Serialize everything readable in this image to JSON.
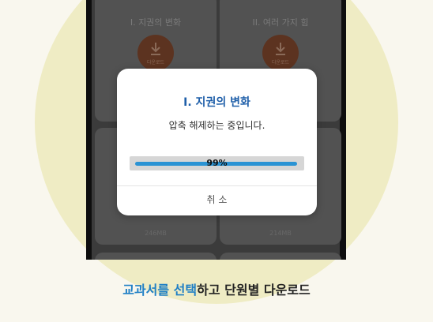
{
  "cards": [
    {
      "title": "I. 지권의 변화",
      "download_label": "다운로드",
      "size": ""
    },
    {
      "title": "II. 여러 가지 힘",
      "download_label": "다운로드",
      "size": ""
    },
    {
      "title": "",
      "download_label": "",
      "size": "246MB"
    },
    {
      "title": "",
      "download_label": "",
      "size": "214MB"
    }
  ],
  "dialog": {
    "title": "I. 지권의 변화",
    "message": "압축 해제하는 중입니다.",
    "progress_percent": 99,
    "progress_text": "99%",
    "cancel_label": "취 소"
  },
  "caption": {
    "highlight": "교과서를 선택",
    "rest": "하고 단원별 다운로드"
  },
  "colors": {
    "accent": "#1f5fa9",
    "progress": "#2a93d4",
    "caption_highlight": "#1f7fc5"
  }
}
